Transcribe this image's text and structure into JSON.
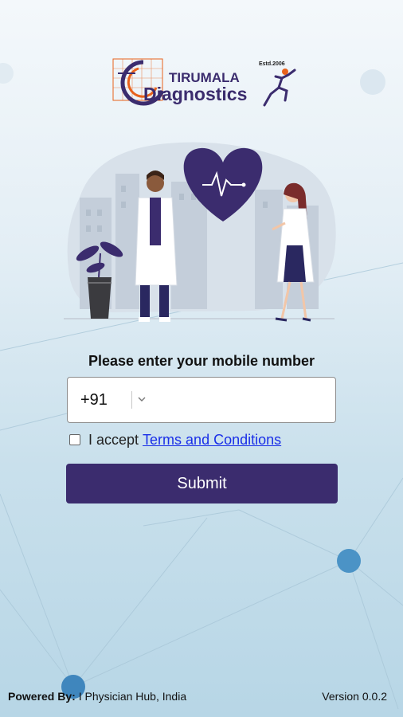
{
  "brand": {
    "name_top": "TIRUMALA",
    "name_bottom": "Diagnostics",
    "established": "Estd.2006"
  },
  "login": {
    "prompt": "Please enter your mobile number",
    "country_code": "+91",
    "phone_value": "",
    "accept_text": "I accept",
    "terms_link": "Terms and Conditions",
    "submit_label": "Submit",
    "terms_checked": false
  },
  "footer": {
    "powered_by_label": "Powered By:",
    "powered_by_value": "I Physician Hub, India",
    "version": "Version 0.0.2"
  },
  "colors": {
    "primary": "#3b2c6e",
    "link": "#1a2fe8",
    "accent_orange": "#e8621c",
    "node_blue": "#4b93c6"
  },
  "icons": [
    "hospital-grid-logo",
    "runner-logo",
    "heart-pulse-icon",
    "plant-icon",
    "chevron-down-icon"
  ]
}
